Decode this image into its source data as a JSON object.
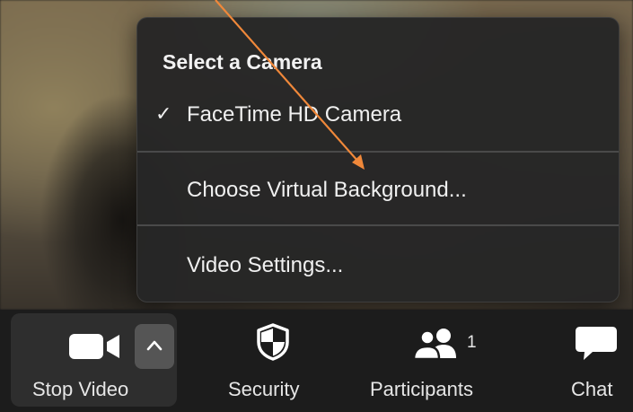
{
  "camera_menu": {
    "heading": "Select a Camera",
    "check_mark": "✓",
    "items": [
      {
        "label": "FaceTime HD Camera",
        "selected": true
      },
      {
        "label": "Choose Virtual Background...",
        "selected": false
      },
      {
        "label": "Video Settings...",
        "selected": false
      }
    ]
  },
  "toolbar": {
    "stop_video_label": "Stop Video",
    "security_label": "Security",
    "participants_label": "Participants",
    "participants_count": "1",
    "chat_label": "Chat"
  },
  "icons": {
    "camera": "video-camera-icon",
    "caret": "chevron-up-icon",
    "security": "shield-icon",
    "participants": "people-icon",
    "chat": "speech-bubble-icon",
    "check": "checkmark-icon"
  },
  "colors": {
    "annotation_arrow": "#f0883a",
    "menu_background": "#262626",
    "toolbar_background": "#1c1c1c",
    "stop_video_highlight": "#2e2e2e"
  }
}
